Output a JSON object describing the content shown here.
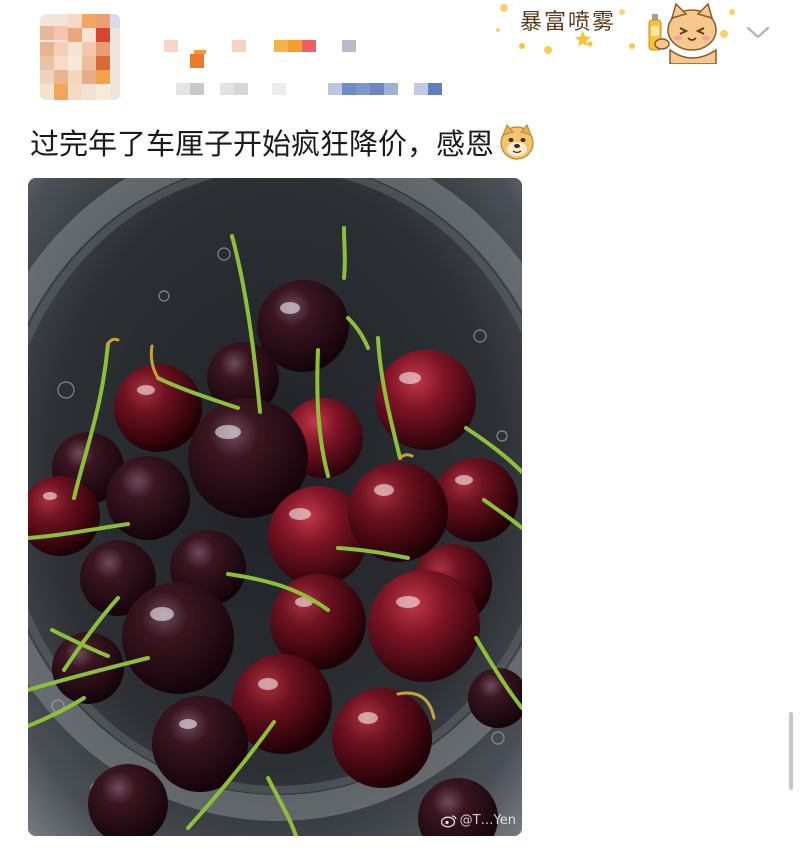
{
  "post": {
    "text": "过完年了车厘子开始疯狂降价，感恩",
    "emoji": "doge-emoji"
  },
  "decoration": {
    "text": "暴富喷雾",
    "icon": "cat-with-spray-bottle"
  },
  "header": {
    "avatar": "blurred-avatar",
    "username": "",
    "meta": "",
    "menu_icon": "chevron-down-icon"
  },
  "photo": {
    "description_icon": "weibo-logo-icon",
    "watermark": "@T…Yen"
  },
  "colors": {
    "text": "#1a1a1a",
    "chevron": "#b5b5b5",
    "cherry": "#5a0d16",
    "stem": "#8cbf3a"
  }
}
